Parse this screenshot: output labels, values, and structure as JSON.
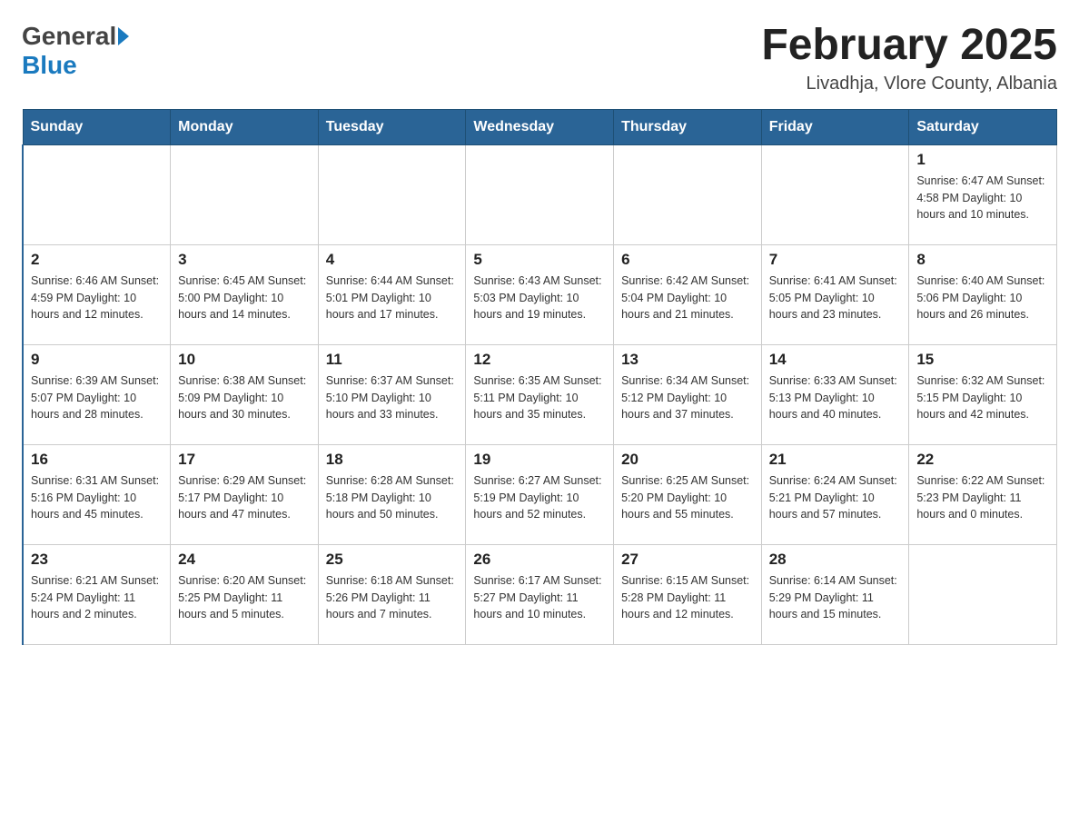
{
  "header": {
    "logo": {
      "general": "General",
      "blue": "Blue",
      "arrow_title": "GeneralBlue logo"
    },
    "title": "February 2025",
    "location": "Livadhja, Vlore County, Albania"
  },
  "calendar": {
    "days_of_week": [
      "Sunday",
      "Monday",
      "Tuesday",
      "Wednesday",
      "Thursday",
      "Friday",
      "Saturday"
    ],
    "weeks": [
      [
        {
          "day": "",
          "info": ""
        },
        {
          "day": "",
          "info": ""
        },
        {
          "day": "",
          "info": ""
        },
        {
          "day": "",
          "info": ""
        },
        {
          "day": "",
          "info": ""
        },
        {
          "day": "",
          "info": ""
        },
        {
          "day": "1",
          "info": "Sunrise: 6:47 AM\nSunset: 4:58 PM\nDaylight: 10 hours and 10 minutes."
        }
      ],
      [
        {
          "day": "2",
          "info": "Sunrise: 6:46 AM\nSunset: 4:59 PM\nDaylight: 10 hours and 12 minutes."
        },
        {
          "day": "3",
          "info": "Sunrise: 6:45 AM\nSunset: 5:00 PM\nDaylight: 10 hours and 14 minutes."
        },
        {
          "day": "4",
          "info": "Sunrise: 6:44 AM\nSunset: 5:01 PM\nDaylight: 10 hours and 17 minutes."
        },
        {
          "day": "5",
          "info": "Sunrise: 6:43 AM\nSunset: 5:03 PM\nDaylight: 10 hours and 19 minutes."
        },
        {
          "day": "6",
          "info": "Sunrise: 6:42 AM\nSunset: 5:04 PM\nDaylight: 10 hours and 21 minutes."
        },
        {
          "day": "7",
          "info": "Sunrise: 6:41 AM\nSunset: 5:05 PM\nDaylight: 10 hours and 23 minutes."
        },
        {
          "day": "8",
          "info": "Sunrise: 6:40 AM\nSunset: 5:06 PM\nDaylight: 10 hours and 26 minutes."
        }
      ],
      [
        {
          "day": "9",
          "info": "Sunrise: 6:39 AM\nSunset: 5:07 PM\nDaylight: 10 hours and 28 minutes."
        },
        {
          "day": "10",
          "info": "Sunrise: 6:38 AM\nSunset: 5:09 PM\nDaylight: 10 hours and 30 minutes."
        },
        {
          "day": "11",
          "info": "Sunrise: 6:37 AM\nSunset: 5:10 PM\nDaylight: 10 hours and 33 minutes."
        },
        {
          "day": "12",
          "info": "Sunrise: 6:35 AM\nSunset: 5:11 PM\nDaylight: 10 hours and 35 minutes."
        },
        {
          "day": "13",
          "info": "Sunrise: 6:34 AM\nSunset: 5:12 PM\nDaylight: 10 hours and 37 minutes."
        },
        {
          "day": "14",
          "info": "Sunrise: 6:33 AM\nSunset: 5:13 PM\nDaylight: 10 hours and 40 minutes."
        },
        {
          "day": "15",
          "info": "Sunrise: 6:32 AM\nSunset: 5:15 PM\nDaylight: 10 hours and 42 minutes."
        }
      ],
      [
        {
          "day": "16",
          "info": "Sunrise: 6:31 AM\nSunset: 5:16 PM\nDaylight: 10 hours and 45 minutes."
        },
        {
          "day": "17",
          "info": "Sunrise: 6:29 AM\nSunset: 5:17 PM\nDaylight: 10 hours and 47 minutes."
        },
        {
          "day": "18",
          "info": "Sunrise: 6:28 AM\nSunset: 5:18 PM\nDaylight: 10 hours and 50 minutes."
        },
        {
          "day": "19",
          "info": "Sunrise: 6:27 AM\nSunset: 5:19 PM\nDaylight: 10 hours and 52 minutes."
        },
        {
          "day": "20",
          "info": "Sunrise: 6:25 AM\nSunset: 5:20 PM\nDaylight: 10 hours and 55 minutes."
        },
        {
          "day": "21",
          "info": "Sunrise: 6:24 AM\nSunset: 5:21 PM\nDaylight: 10 hours and 57 minutes."
        },
        {
          "day": "22",
          "info": "Sunrise: 6:22 AM\nSunset: 5:23 PM\nDaylight: 11 hours and 0 minutes."
        }
      ],
      [
        {
          "day": "23",
          "info": "Sunrise: 6:21 AM\nSunset: 5:24 PM\nDaylight: 11 hours and 2 minutes."
        },
        {
          "day": "24",
          "info": "Sunrise: 6:20 AM\nSunset: 5:25 PM\nDaylight: 11 hours and 5 minutes."
        },
        {
          "day": "25",
          "info": "Sunrise: 6:18 AM\nSunset: 5:26 PM\nDaylight: 11 hours and 7 minutes."
        },
        {
          "day": "26",
          "info": "Sunrise: 6:17 AM\nSunset: 5:27 PM\nDaylight: 11 hours and 10 minutes."
        },
        {
          "day": "27",
          "info": "Sunrise: 6:15 AM\nSunset: 5:28 PM\nDaylight: 11 hours and 12 minutes."
        },
        {
          "day": "28",
          "info": "Sunrise: 6:14 AM\nSunset: 5:29 PM\nDaylight: 11 hours and 15 minutes."
        },
        {
          "day": "",
          "info": ""
        }
      ]
    ]
  }
}
